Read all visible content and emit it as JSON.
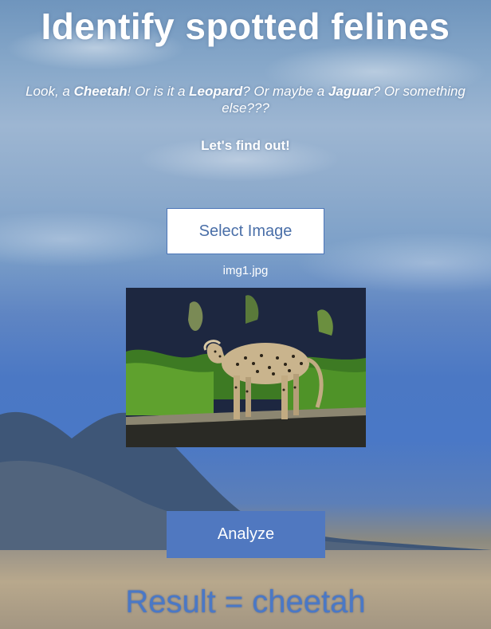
{
  "header": {
    "title": "Identify spotted felines"
  },
  "intro": {
    "t1": "Look, a ",
    "cheetah": "Cheetah",
    "t2": "! Or is it a ",
    "leopard": "Leopard",
    "t3": "? Or maybe a ",
    "jaguar": "Jaguar",
    "t4": "? Or something else???",
    "find_out": "Let's find out!"
  },
  "upload": {
    "select_label": "Select Image",
    "filename": "img1.jpg"
  },
  "actions": {
    "analyze_label": "Analyze"
  },
  "result": {
    "text": "Result = cheetah"
  },
  "colors": {
    "accent": "#5078c0",
    "button_text": "#4a6fa8",
    "result_text": "#4a78c6",
    "heading_text": "#ffffff"
  },
  "icons": {
    "preview": "cheetah-photo"
  }
}
